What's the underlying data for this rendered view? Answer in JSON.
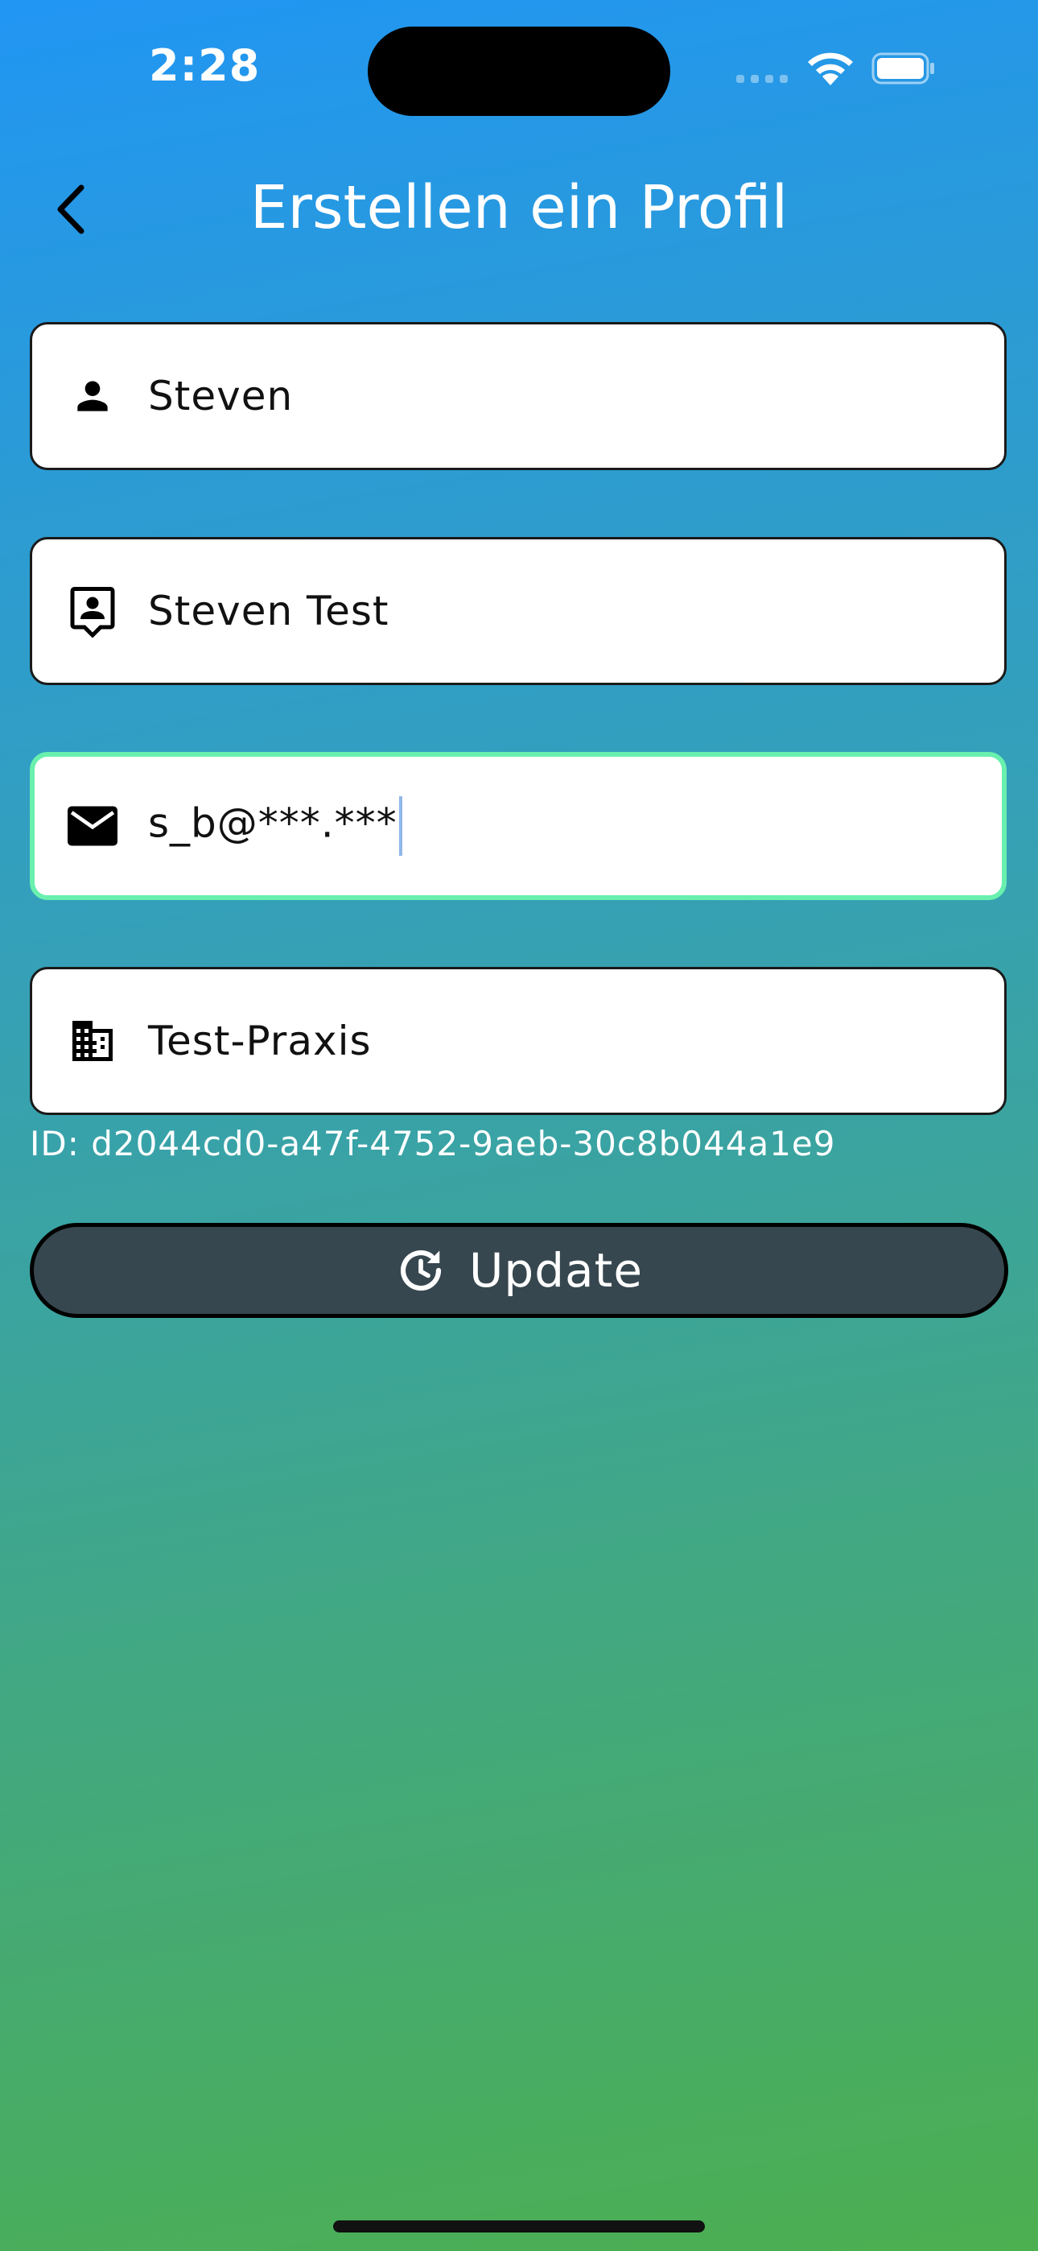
{
  "status_bar": {
    "time": "2:28",
    "icons": [
      "cellular-signal-icon",
      "wifi-icon",
      "battery-icon"
    ]
  },
  "header": {
    "title": "Erstellen ein Profil",
    "back_icon": "chevron-left-icon"
  },
  "fields": [
    {
      "icon": "person-icon",
      "value": "Steven"
    },
    {
      "icon": "contact-card-icon",
      "value": "Steven Test"
    },
    {
      "icon": "mail-icon",
      "value": "s_b@***.***"
    },
    {
      "icon": "business-icon",
      "value": "Test-Praxis"
    }
  ],
  "profile_id": "ID: d2044cd0-a47f-4752-9aeb-30c8b044a1e9",
  "update_button": {
    "label": "Update",
    "icon": "update-icon"
  },
  "colors": {
    "gradient_top": "#2196F3",
    "gradient_bottom": "#4CAF50",
    "focus_border": "#69F0AE",
    "button_bg": "#37474F",
    "field_bg": "#FFFFFF"
  }
}
